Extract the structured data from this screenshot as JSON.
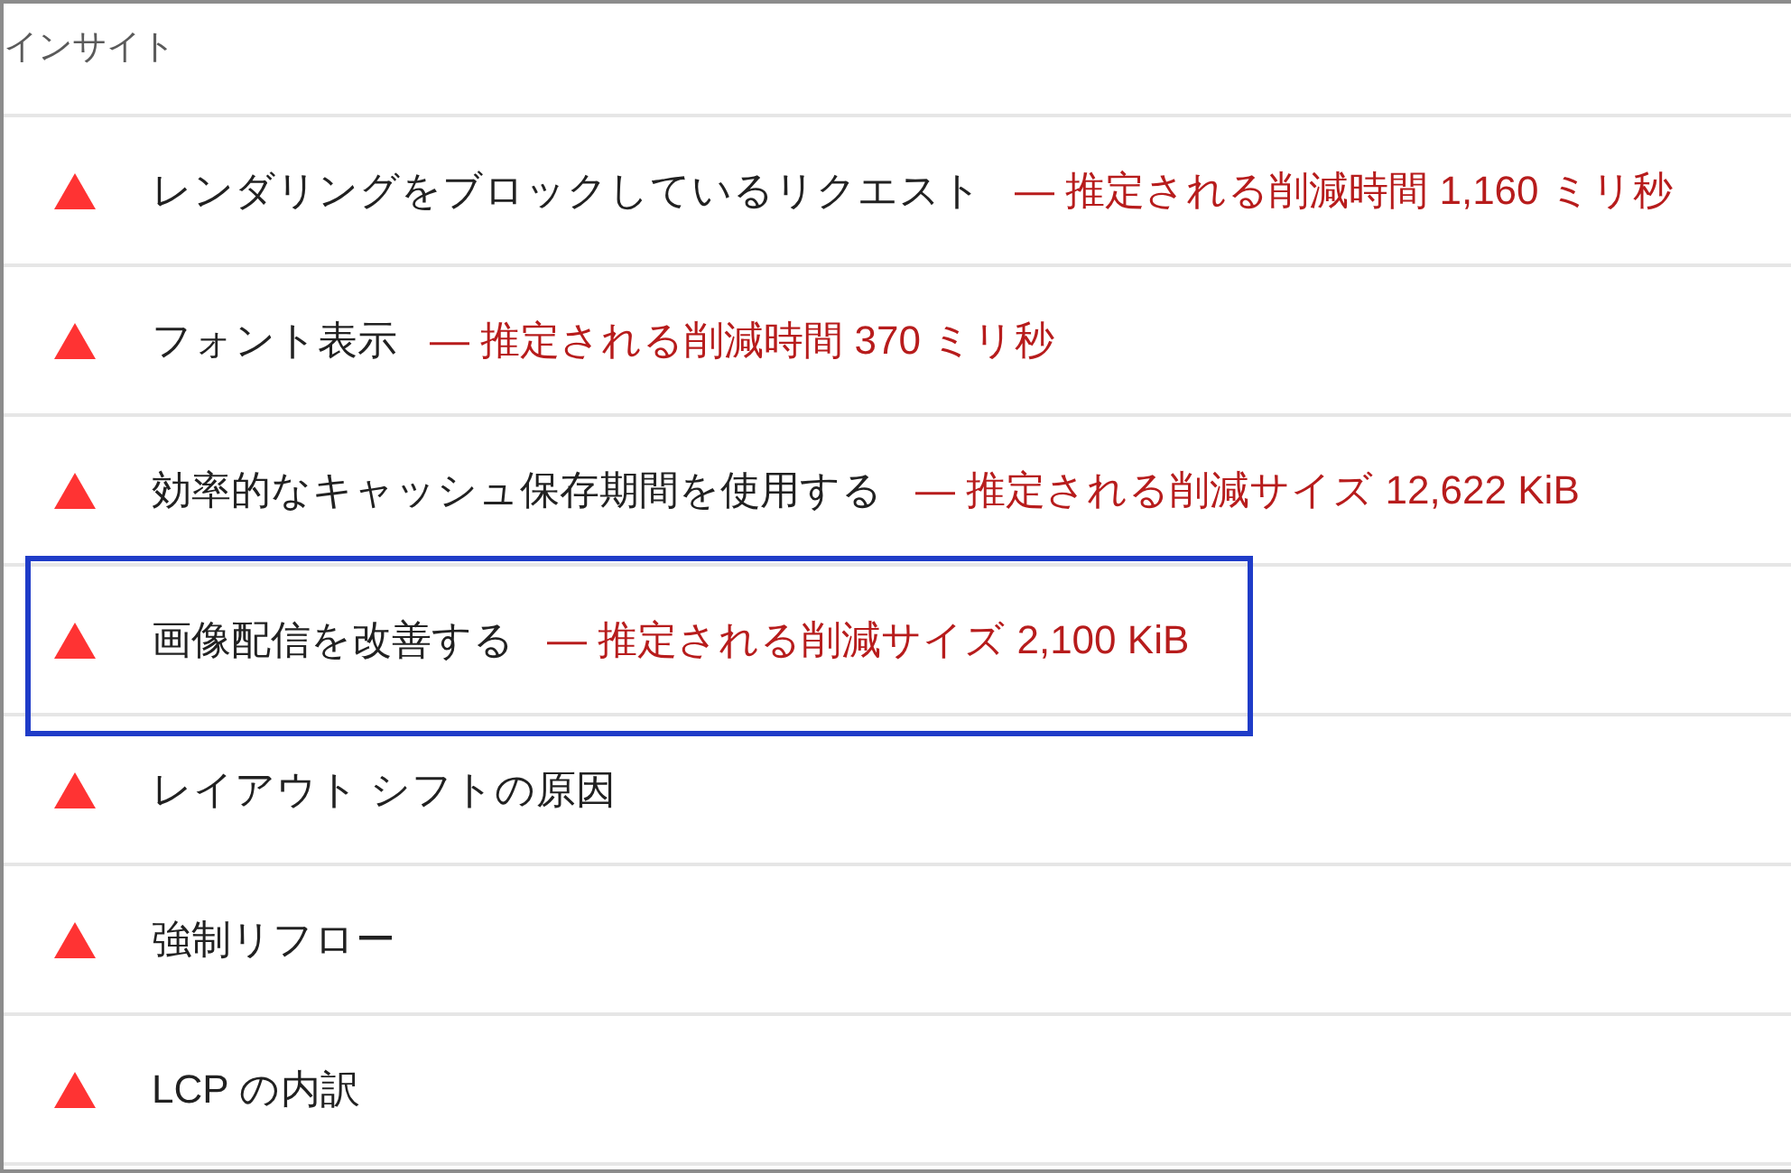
{
  "section": {
    "title": "インサイト"
  },
  "insights": [
    {
      "title": "レンダリングをブロックしているリクエスト",
      "savings": "— 推定される削減時間 1,160 ミリ秒",
      "highlighted": false
    },
    {
      "title": "フォント表示",
      "savings": "— 推定される削減時間 370 ミリ秒",
      "highlighted": false
    },
    {
      "title": "効率的なキャッシュ保存期間を使用する",
      "savings": "— 推定される削減サイズ 12,622 KiB",
      "highlighted": false
    },
    {
      "title": "画像配信を改善する",
      "savings": "— 推定される削減サイズ 2,100 KiB",
      "highlighted": true
    },
    {
      "title": "レイアウト シフトの原因",
      "highlighted": false
    },
    {
      "title": "強制リフロー",
      "highlighted": false
    },
    {
      "title": "LCP の内訳",
      "highlighted": false
    }
  ]
}
